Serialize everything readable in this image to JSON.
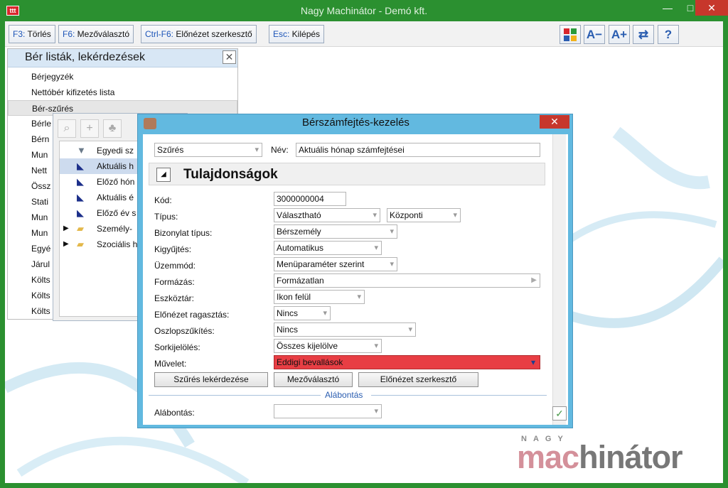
{
  "window": {
    "title": "Nagy Machinátor - Demó kft."
  },
  "toolbar": {
    "buttons": [
      {
        "key": "F3:",
        "label": " Törlés"
      },
      {
        "key": "F6:",
        "label": " Mezőválasztó"
      },
      {
        "key": "Ctrl-F6:",
        "label": " Előnézet szerkesztő"
      },
      {
        "key": "Esc:",
        "label": " Kilépés"
      }
    ],
    "icon_glyphs": {
      "font_smaller": "A",
      "font_larger": "A",
      "help": "?"
    }
  },
  "left_panel": {
    "title": "Bér listák, lekérdezések",
    "items": [
      "Bérjegyzék",
      "Nettóbér kifizetés lista",
      "Bér-szűrés",
      "Bérle",
      "Bérn",
      "Mun",
      "Nett",
      "Össz",
      "Stati",
      "Mun",
      "Mun",
      "Egyé",
      "Járul",
      "Költs",
      "Költs",
      "Költs"
    ]
  },
  "sub_window": {
    "tree_items": [
      "Egyedi sz",
      "Aktuális h",
      "Előző hón",
      "Aktuális é",
      "Előző év s",
      "Személy-",
      "Szociális h"
    ]
  },
  "dialog": {
    "title": "Bérszámfejtés-kezelés",
    "type_combo": "Szűrés",
    "name_label": "Név:",
    "name_value": "Aktuális hónap számfejtései",
    "section_title": "Tulajdonságok",
    "fields": {
      "kod": {
        "label": "Kód:",
        "value": "3000000004"
      },
      "tipus": {
        "label": "Típus:",
        "value": "Választható",
        "value2": "Központi"
      },
      "bizonylat": {
        "label": "Bizonylat típus:",
        "value": "Bérszemély"
      },
      "kigyujtes": {
        "label": "Kigyűjtés:",
        "value": "Automatikus"
      },
      "uzemmod": {
        "label": "Üzemmód:",
        "value": "Menüparaméter szerint"
      },
      "formazas": {
        "label": "Formázás:",
        "value": "Formázatlan"
      },
      "eszkoztar": {
        "label": "Eszköztár:",
        "value": "Ikon felül"
      },
      "elonezet": {
        "label": "Előnézet ragasztás:",
        "value": "Nincs"
      },
      "oszlop": {
        "label": "Oszlopszűkítés:",
        "value": "Nincs"
      },
      "sorkijeloles": {
        "label": "Sorkijelölés:",
        "value": "Összes kijelölve"
      },
      "muvelet": {
        "label": "Művelet:",
        "value": "Eddigi bevallások"
      }
    },
    "buttons": {
      "query": "Szűrés lekérdezése",
      "field_selector": "Mezőválasztó",
      "preview_editor": "Előnézet szerkesztő"
    },
    "sub_section": "Alábontás",
    "alabontas_label": "Alábontás:",
    "alabontas_value": ""
  },
  "logo": {
    "small": "NAGY",
    "part1": "mac",
    "part2": "hinátor"
  },
  "colors": {
    "frame": "#2b9030",
    "dialog_frame": "#62b9e0",
    "highlight": "#e83e44",
    "close": "#c7372c"
  }
}
